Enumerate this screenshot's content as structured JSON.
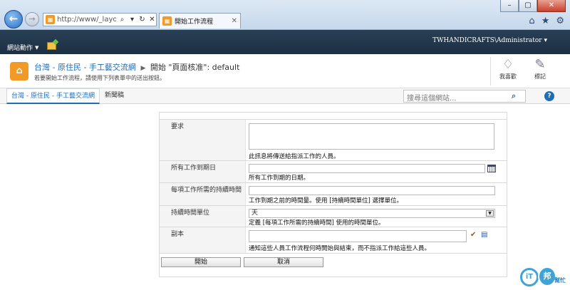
{
  "browser": {
    "address": "http://www/_layouts",
    "tab_title": "開始工作流程"
  },
  "ribbon": {
    "site_actions": "網站動作",
    "user": "TWHANDICRAFTS\\Administrator"
  },
  "title_area": {
    "site_name": "台灣 - 原住民 - 手工藝交流網",
    "page_title": "開始 \"頁面核准\": default",
    "description": "若要開始工作流程，請使用下列表單中的送出按鈕。",
    "like_label": "我喜歡",
    "tags_label": "標記"
  },
  "topnav": {
    "items": [
      "台灣 - 原住民 - 手工藝交流網",
      "新聞稿"
    ],
    "search_placeholder": "搜尋這個網站..."
  },
  "form": {
    "request": {
      "label": "要求",
      "desc": "此訊息將傳送給指派工作的人員。",
      "value": ""
    },
    "due_date": {
      "label": "所有工作到期日",
      "desc": "所有工作到期的日期。",
      "value": ""
    },
    "duration": {
      "label": "每項工作所需的持續時間",
      "desc": "工作到期之前的時間量。使用 [持續時間單位] 選擇單位。",
      "value": ""
    },
    "duration_unit": {
      "label": "持續時間單位",
      "desc": "定義 [每項工作所需的持續時間] 使用的時間單位。",
      "value": "天"
    },
    "cc": {
      "label": "副本",
      "desc": "通知這些人員工作流程何時開始與結束，而不指派工作給這些人員。",
      "value": ""
    },
    "start_button": "開始",
    "cancel_button": "取消"
  },
  "watermark": {
    "text_it": "iT",
    "text_bang": "邦",
    "text_help": "幫忙"
  }
}
